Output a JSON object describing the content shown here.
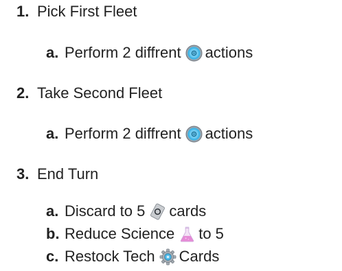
{
  "steps": [
    {
      "marker": "1.",
      "text": "Pick First Fleet",
      "substeps": [
        {
          "marker": "a.",
          "before": "Perform 2 diffrent",
          "icon": "action-disc-icon",
          "after": "actions"
        }
      ]
    },
    {
      "marker": "2.",
      "text": "Take Second Fleet",
      "substeps": [
        {
          "marker": "a.",
          "before": "Perform 2 diffrent",
          "icon": "action-disc-icon",
          "after": "actions"
        }
      ]
    },
    {
      "marker": "3.",
      "text": "End Turn",
      "substeps": [
        {
          "marker": "a.",
          "before": "Discard to 5",
          "icon": "card-icon",
          "after": "cards"
        },
        {
          "marker": "b.",
          "before": "Reduce Science",
          "icon": "flask-icon",
          "after": "to 5"
        },
        {
          "marker": "c.",
          "before": "Restock Tech",
          "icon": "gear-icon",
          "after": "Cards"
        }
      ]
    }
  ]
}
